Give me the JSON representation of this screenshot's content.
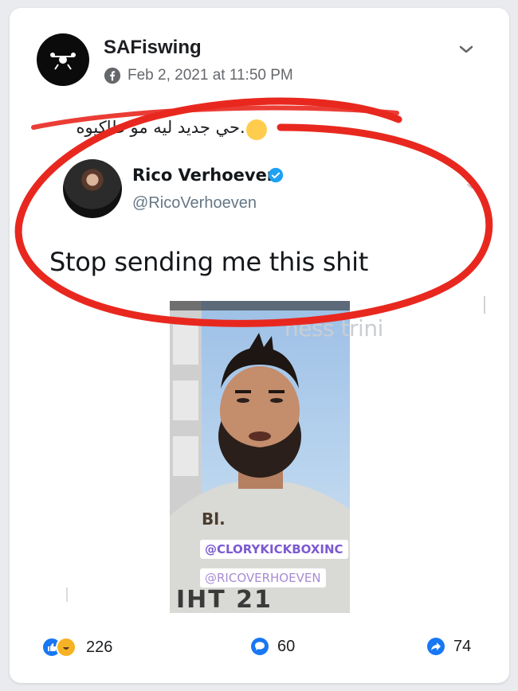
{
  "post": {
    "author": "SAFiswing",
    "timestamp": "Feb 2, 2021 at 11:50 PM",
    "text": "...حي جديد ليه مو طاكيوه"
  },
  "tweet": {
    "name": "Rico Verhoeven",
    "handle": "@RicoVerhoeven",
    "text": "Stop sending me this shit"
  },
  "image": {
    "watermark": "ness trini",
    "sticker_emoji_text": "Bl.",
    "sticker_1": "@CLORYKICKBOXINC",
    "sticker_2": "@RICOVERHOEVEN",
    "shirt_text": "IHT 21"
  },
  "footer": {
    "reactions_count": "226",
    "comments_count": "60",
    "shares_count": "74"
  },
  "colors": {
    "facebook_blue": "#1877f2",
    "annotation_red": "#e8281f",
    "twitter_verified": "#1da1f2"
  },
  "icons": {
    "chevron": "chevron-down-icon",
    "globe": "facebook-icon",
    "verified": "verified-badge-icon",
    "comment": "comment-icon",
    "share": "share-icon"
  }
}
